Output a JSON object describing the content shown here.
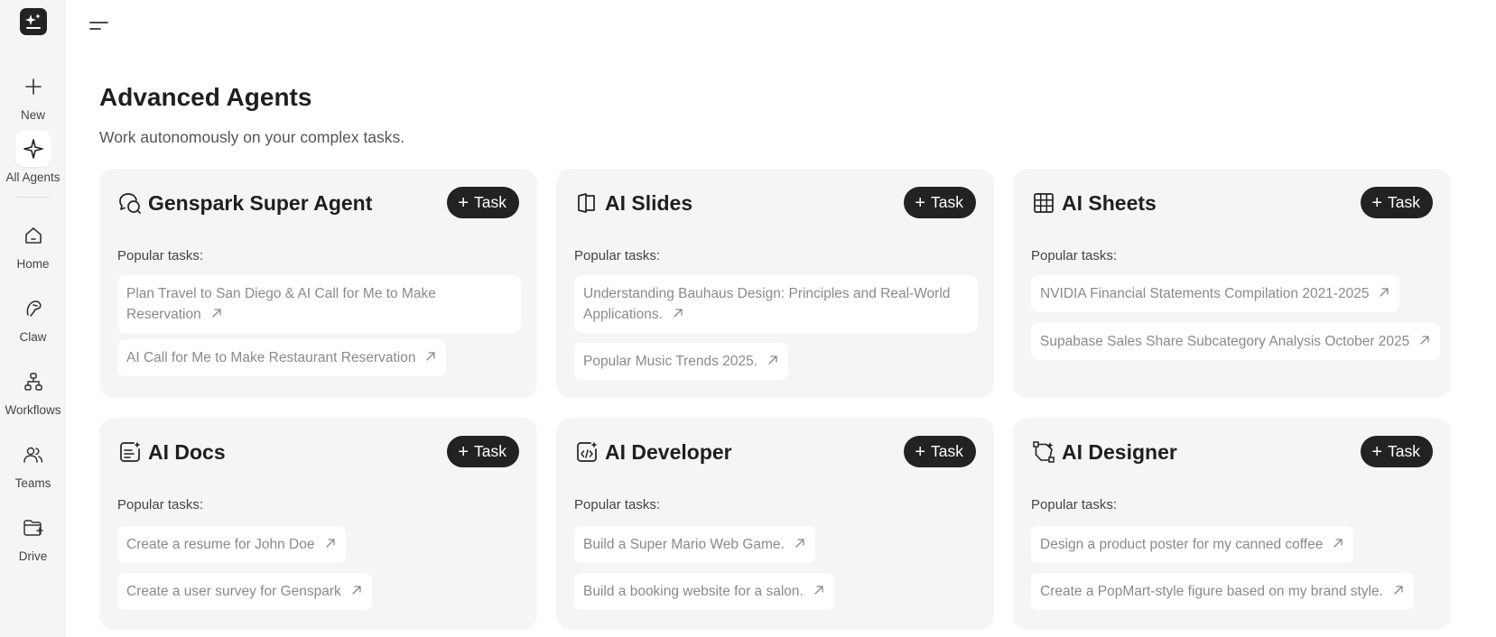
{
  "sidebar": {
    "items": [
      {
        "label": "New",
        "icon": "plus-icon"
      },
      {
        "label": "All Agents",
        "icon": "sparkle-icon"
      },
      {
        "label": "Home",
        "icon": "home-icon"
      },
      {
        "label": "Claw",
        "icon": "claw-icon"
      },
      {
        "label": "Workflows",
        "icon": "workflow-icon"
      },
      {
        "label": "Teams",
        "icon": "teams-icon"
      },
      {
        "label": "Drive",
        "icon": "drive-icon"
      }
    ]
  },
  "header": {
    "title": "Advanced Agents",
    "subtitle": "Work autonomously on your complex tasks."
  },
  "task_label": "Task",
  "popular_label": "Popular tasks:",
  "cards": [
    {
      "title": "Genspark Super Agent",
      "icon": "chat-bubbles-icon",
      "tasks": [
        "Plan Travel to San Diego & AI Call for Me to Make Reservation",
        "AI Call for Me to Make Restaurant Reservation"
      ]
    },
    {
      "title": "AI Slides",
      "icon": "slides-icon",
      "tasks": [
        "Understanding Bauhaus Design: Principles and Real-World Applications.",
        "Popular Music Trends 2025."
      ]
    },
    {
      "title": "AI Sheets",
      "icon": "grid-icon",
      "tasks": [
        "NVIDIA Financial Statements Compilation 2021-2025",
        "Supabase Sales Share Subcategory Analysis October 2025"
      ]
    },
    {
      "title": "AI Docs",
      "icon": "document-icon",
      "tasks": [
        "Create a resume for John Doe",
        "Create a user survey for Genspark"
      ]
    },
    {
      "title": "AI Developer",
      "icon": "code-icon",
      "tasks": [
        "Build a Super Mario Web Game.",
        "Build a booking website for a salon."
      ]
    },
    {
      "title": "AI Designer",
      "icon": "design-icon",
      "tasks": [
        "Design a product poster for my canned coffee",
        "Create a PopMart-style figure based on my brand style."
      ]
    }
  ]
}
